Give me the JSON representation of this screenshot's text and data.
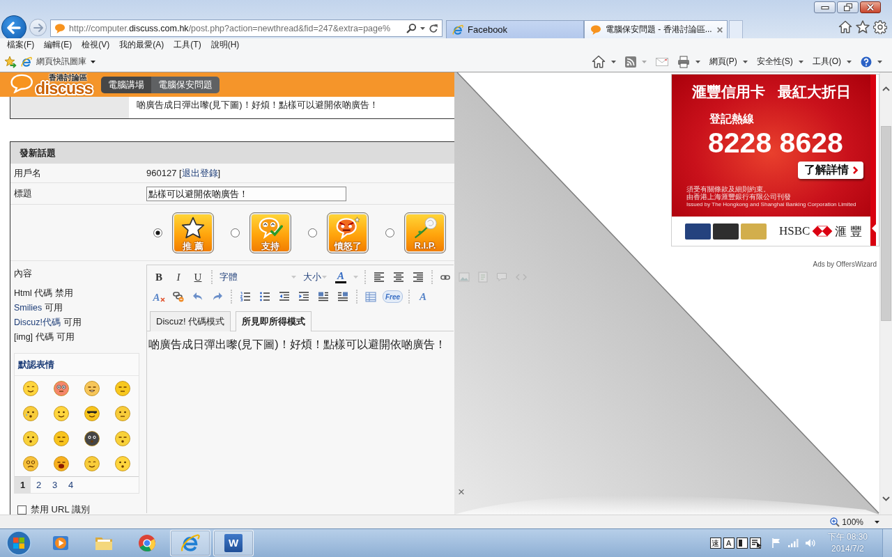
{
  "browser": {
    "tabs": [
      {
        "kind": "web",
        "label": "Facebook",
        "selected": false
      },
      {
        "kind": "forum",
        "label": "電腦保安問題 - 香港討論區...",
        "selected": true
      }
    ],
    "address": {
      "start": "http://computer.",
      "domain": "discuss.com.hk",
      "rest": "/post.php?action=newthread&fid=247&extra=page%"
    }
  },
  "menu": [
    "檔案(F)",
    "編輯(E)",
    "檢視(V)",
    "我的最愛(A)",
    "工具(T)",
    "說明(H)"
  ],
  "favorites_bar": {
    "link": "網頁快訊圖庫"
  },
  "command_bar": [
    {
      "kind": "home",
      "dropdown": true,
      "disabled": false
    },
    {
      "kind": "feed",
      "dropdown": true,
      "disabled": true
    },
    {
      "kind": "mail",
      "dropdown": false,
      "disabled": true
    },
    {
      "kind": "print",
      "dropdown": true,
      "disabled": false
    },
    {
      "kind": "menu",
      "label": "網頁(P)",
      "dropdown": true,
      "disabled": false
    },
    {
      "kind": "menu",
      "label": "安全性(S)",
      "dropdown": true,
      "disabled": false
    },
    {
      "kind": "menu",
      "label": "工具(O)",
      "dropdown": true,
      "disabled": false
    },
    {
      "kind": "help",
      "dropdown": true,
      "disabled": false
    }
  ],
  "site": {
    "tagline": "香港討論區",
    "wordmark": "discuss",
    "breadcrumbs": [
      {
        "label": "電腦講場",
        "current": false
      },
      {
        "label": "電腦保安問題",
        "current": true
      }
    ]
  },
  "quoted_post": {
    "text": "啲廣告成日彈出嚟(見下圖)！好煩！點樣可以避開依啲廣告！"
  },
  "post_form": {
    "title": "發新話題",
    "username": {
      "label": "用戶名",
      "before": "960127 [",
      "link": "退出登錄",
      "after": "]"
    },
    "subject": {
      "label": "標題",
      "value": "點樣可以避開依啲廣告！"
    },
    "moods": [
      {
        "kind": "star",
        "label": "推 薦",
        "selected": true
      },
      {
        "kind": "support",
        "label": "支持",
        "selected": false
      },
      {
        "kind": "angry",
        "label": "憤怒了",
        "selected": false
      },
      {
        "kind": "rose",
        "label": "R.I.P.",
        "selected": false
      }
    ],
    "content_label": "內容",
    "options": [
      {
        "name": "Html 代碼",
        "status": "禁用",
        "link": false
      },
      {
        "name": "Smilies",
        "status": "可用",
        "link": true
      },
      {
        "name": "Discuz!代碼",
        "status": "可用",
        "link": true
      },
      {
        "name": "[img] 代碼",
        "status": "可用",
        "link": false
      }
    ],
    "smilies": {
      "title": "默認表情",
      "faces": [
        {
          "kind": "smile"
        },
        {
          "kind": "shock"
        },
        {
          "kind": "wince"
        },
        {
          "kind": "sleepy"
        },
        {
          "kind": "cry"
        },
        {
          "kind": "love"
        },
        {
          "kind": "cool"
        },
        {
          "kind": "think"
        },
        {
          "kind": "shh"
        },
        {
          "kind": "sweat"
        },
        {
          "kind": "dark"
        },
        {
          "kind": "sneeze"
        },
        {
          "kind": "dizzy"
        },
        {
          "kind": "shout"
        },
        {
          "kind": "shy"
        },
        {
          "kind": "surprise"
        }
      ],
      "pages": [
        {
          "label": "1",
          "selected": true
        },
        {
          "label": "2",
          "selected": false
        },
        {
          "label": "3",
          "selected": false
        },
        {
          "label": "4",
          "selected": false
        }
      ]
    },
    "url_option": {
      "label": "禁用 URL 識別",
      "checked": false
    },
    "editor": {
      "toolbar": [
        [
          {
            "kind": "bold",
            "label": "B"
          },
          {
            "kind": "italic",
            "label": "I"
          },
          {
            "kind": "underline",
            "label": "U"
          },
          {
            "kind": "sep"
          },
          {
            "kind": "font",
            "label": "字體"
          },
          {
            "kind": "size",
            "label": "大小"
          },
          {
            "kind": "color",
            "label": "A"
          },
          {
            "kind": "sep"
          },
          {
            "kind": "align-left"
          },
          {
            "kind": "align-center"
          },
          {
            "kind": "align-right"
          },
          {
            "kind": "sep"
          },
          {
            "kind": "link"
          }
        ],
        [
          {
            "kind": "clear-format",
            "label": "A"
          },
          {
            "kind": "unlink"
          },
          {
            "kind": "undo"
          },
          {
            "kind": "redo"
          },
          {
            "kind": "sep"
          },
          {
            "kind": "ordered-list"
          },
          {
            "kind": "bullet-list"
          },
          {
            "kind": "outdent"
          },
          {
            "kind": "indent"
          },
          {
            "kind": "float-left"
          },
          {
            "kind": "float-right"
          },
          {
            "kind": "sep"
          },
          {
            "kind": "table"
          },
          {
            "kind": "free",
            "label": "Free"
          },
          {
            "kind": "sep"
          },
          {
            "kind": "font-style",
            "label": "A"
          }
        ]
      ],
      "covered_tools": [
        {
          "kind": "image"
        },
        {
          "kind": "media"
        },
        {
          "kind": "quote"
        },
        {
          "kind": "code"
        }
      ],
      "modes": [
        {
          "label": "Discuz! 代碼模式",
          "selected": false
        },
        {
          "label": "所見即所得模式",
          "selected": true
        }
      ],
      "body": "啲廣告成日彈出嚟(見下圖)！好煩！點樣可以避開依啲廣告！"
    }
  },
  "peel_ad": {
    "close": "×"
  },
  "ad": {
    "headline": [
      "滙豐信用卡",
      "最紅大折日"
    ],
    "hotline_label": "登記熱線",
    "hotline": "8228 8628",
    "cta": "了解詳情",
    "fine_print": [
      "須受有關條款及細則約束。",
      "由香港上海滙豐銀行有限公司刊發",
      "Issued by The Hongkong and Shanghai Banking Corporation Limited"
    ],
    "cards": [
      {
        "color": "#24427e"
      },
      {
        "color": "#2e2e2e"
      },
      {
        "color": "#d2ae4c"
      }
    ],
    "brand": "HSBC",
    "brand_local": "滙 豐",
    "attribution": "Ads by OffersWizard"
  },
  "status_bar": {
    "zoom": "100%"
  },
  "taskbar": {
    "apps": [
      {
        "kind": "media",
        "running": false
      },
      {
        "kind": "folder",
        "running": false
      },
      {
        "kind": "round-logo",
        "running": false
      },
      {
        "kind": "letter-e",
        "running": true
      },
      {
        "kind": "word",
        "label": "W",
        "running": true
      }
    ],
    "ime": [
      {
        "label": "速"
      },
      {
        "label": "A"
      }
    ],
    "time": "下午 08:30",
    "date": "2014/7/2"
  }
}
